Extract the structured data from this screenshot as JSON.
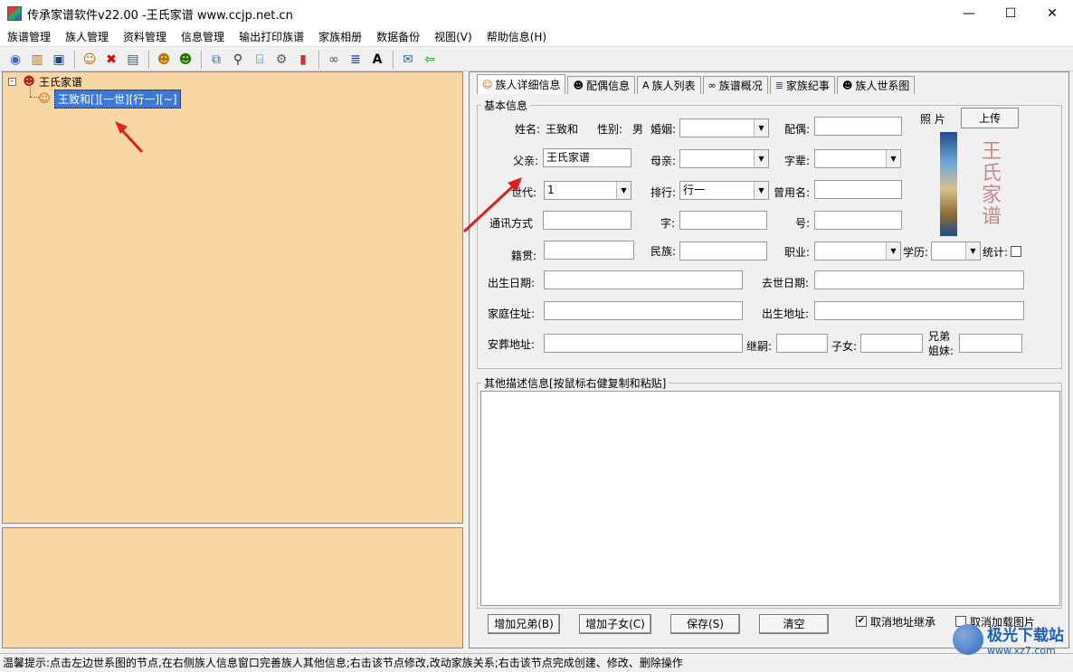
{
  "window": {
    "title": "传承家谱软件v22.00 -王氏家谱 www.ccjp.net.cn",
    "minimize": "—",
    "maximize": "☐",
    "close": "✕"
  },
  "menu": [
    "族谱管理",
    "族人管理",
    "资料管理",
    "信息管理",
    "输出打印族谱",
    "家族相册",
    "数据备份",
    "视图(V)",
    "帮助信息(H)"
  ],
  "tree": {
    "expander": "-",
    "root_label": "王氏家谱",
    "child_label": "王致和[][一世][行一][~]"
  },
  "tabs": [
    "族人详细信息",
    "配偶信息",
    "族人列表",
    "族谱概况",
    "家族纪事",
    "族人世系图"
  ],
  "basic_info": {
    "legend": "基本信息",
    "name_label": "姓名:",
    "name_value": "王致和",
    "gender_label": "性别:",
    "gender_value": "男",
    "marriage_label": "婚姻:",
    "spouse_label": "配偶:",
    "father_label": "父亲:",
    "father_value": "王氏家谱",
    "mother_label": "母亲:",
    "generation_name_label": "字辈:",
    "generation_label": "世代:",
    "generation_value": "1",
    "rank_label": "排行:",
    "rank_value": "行一",
    "former_name_label": "曾用名:",
    "contact_label": "通讯方式",
    "courtesy_label": "字:",
    "alias_label": "号:",
    "origin_label": "籍贯:",
    "ethnicity_label": "民族:",
    "occupation_label": "职业:",
    "education_label": "学历:",
    "stats_label": "统计:",
    "birth_label": "出生日期:",
    "death_label": "去世日期:",
    "home_label": "家庭住址:",
    "birthplace_label": "出生地址:",
    "burial_label": "安葬地址:",
    "heir_label": "继嗣:",
    "children_label": "子女:",
    "siblings_label_1": "兄弟",
    "siblings_label_2": "姐妹:",
    "photo_label": "照  片",
    "upload_label": "上传",
    "photo_watermark": "王氏家谱"
  },
  "other_info": {
    "legend": "其他描述信息[按鼠标右健复制和粘贴]"
  },
  "buttons": {
    "add_sibling": "增加兄弟(B)",
    "add_child": "增加子女(C)",
    "save": "保存(S)",
    "clear": "清空",
    "cancel_addr_inherit": "取消地址继承",
    "cancel_load_image": "取消加载图片"
  },
  "checks": {
    "cancel_addr_inherit": true,
    "cancel_load_image": false,
    "stats": false
  },
  "status": "温馨提示:点击左边世系图的节点,在右侧族人信息窗口完善族人其他信息;右击该节点修改,改动家族关系;右击该节点完成创建、修改、删除操作",
  "watermark": {
    "title": "极光下载站",
    "url": "www.xz7.com"
  },
  "colors": {
    "tree_bg": "#fad6a5",
    "selection": "#3e78d6",
    "arrow": "#e02020"
  }
}
